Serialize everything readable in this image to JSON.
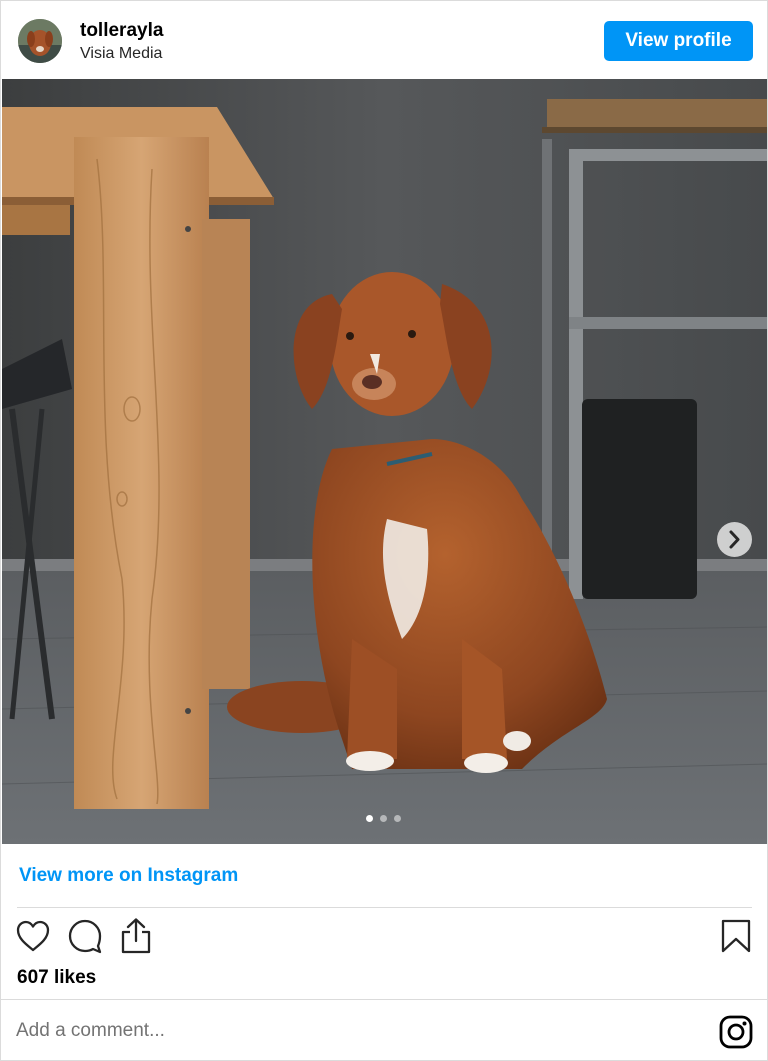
{
  "header": {
    "username": "tollerayla",
    "subtitle": "Visia Media",
    "view_profile_label": "View profile"
  },
  "media": {
    "description_icon": "dog-photo",
    "carousel_count": 3,
    "carousel_active": 1
  },
  "links": {
    "view_more": "View more on Instagram"
  },
  "actions": {
    "icons": [
      "heart-icon",
      "comment-icon",
      "share-icon",
      "bookmark-icon"
    ]
  },
  "stats": {
    "likes": "607 likes"
  },
  "comment": {
    "placeholder": "Add a comment..."
  },
  "colors": {
    "accent": "#0095f6"
  }
}
